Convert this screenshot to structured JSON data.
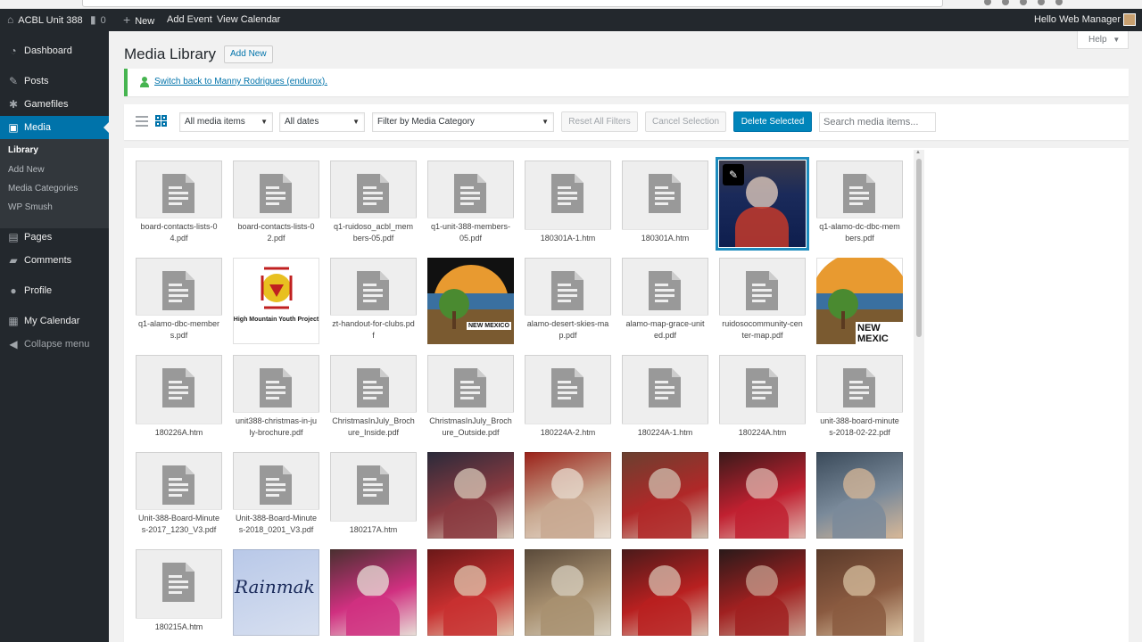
{
  "adminbar": {
    "site_name": "ACBL Unit 388",
    "comments_count": "0",
    "new_label": "New",
    "add_event_label": "Add Event",
    "view_calendar_label": "View Calendar",
    "greeting": "Hello Web Manager"
  },
  "sidebar": {
    "items": [
      {
        "key": "dashboard",
        "label": "Dashboard",
        "icon": "dashboard-icon"
      },
      {
        "key": "posts",
        "label": "Posts",
        "icon": "pin-icon"
      },
      {
        "key": "gamefiles",
        "label": "Gamefiles",
        "icon": "gear-icon"
      },
      {
        "key": "media",
        "label": "Media",
        "icon": "media-icon"
      },
      {
        "key": "pages",
        "label": "Pages",
        "icon": "page-icon"
      },
      {
        "key": "comments",
        "label": "Comments",
        "icon": "comment-icon"
      },
      {
        "key": "profile",
        "label": "Profile",
        "icon": "user-icon"
      },
      {
        "key": "calendar",
        "label": "My Calendar",
        "icon": "calendar-icon"
      },
      {
        "key": "collapse",
        "label": "Collapse menu",
        "icon": "collapse-icon"
      }
    ],
    "submenu": [
      "Library",
      "Add New",
      "Media Categories",
      "WP Smush"
    ]
  },
  "header": {
    "help_label": "Help",
    "title": "Media Library",
    "add_new_label": "Add New"
  },
  "notice": {
    "switch_back_text": "Switch back to Manny Rodrigues (endurox)."
  },
  "toolbar": {
    "filter_type": "All media items",
    "filter_date": "All dates",
    "filter_category": "Filter by Media Category",
    "reset_filters_label": "Reset All Filters",
    "cancel_selection_label": "Cancel Selection",
    "delete_selected_label": "Delete Selected",
    "search_placeholder": "Search media items..."
  },
  "media_grid": {
    "items": [
      {
        "name": "board-contacts-lists-04.pdf",
        "kind": "doc"
      },
      {
        "name": "board-contacts-lists-02.pdf",
        "kind": "doc"
      },
      {
        "name": "q1-ruidoso_acbl_members-05.pdf",
        "kind": "doc"
      },
      {
        "name": "q1-unit-388-members-05.pdf",
        "kind": "doc"
      },
      {
        "name": "180301A-1.htm",
        "kind": "doc"
      },
      {
        "name": "180301A.htm",
        "kind": "doc"
      },
      {
        "name": "",
        "kind": "photo",
        "selected": true
      },
      {
        "name": "q1-alamo-dc-dbc-members.pdf",
        "kind": "doc"
      },
      {
        "name": "q1-alamo-dbc-members.pdf",
        "kind": "doc"
      },
      {
        "name": "",
        "kind": "logo",
        "caption": "High Mountain Youth Project"
      },
      {
        "name": "zt-handout-for-clubs.pdf",
        "kind": "doc"
      },
      {
        "name": "",
        "kind": "badge",
        "caption": "NEW MEXICO"
      },
      {
        "name": "alamo-desert-skies-map.pdf",
        "kind": "doc"
      },
      {
        "name": "alamo-map-grace-united.pdf",
        "kind": "doc"
      },
      {
        "name": "ruidosocommunity-center-map.pdf",
        "kind": "doc"
      },
      {
        "name": "",
        "kind": "badge2",
        "caption": "NEW MEXIC"
      },
      {
        "name": "180226A.htm",
        "kind": "doc"
      },
      {
        "name": "unit388-christmas-in-july-brochure.pdf",
        "kind": "doc"
      },
      {
        "name": "ChristmasInJuly_Brochure_Inside.pdf",
        "kind": "doc"
      },
      {
        "name": "ChristmasInJuly_Brochure_Outside.pdf",
        "kind": "doc"
      },
      {
        "name": "180224A-2.htm",
        "kind": "doc"
      },
      {
        "name": "180224A-1.htm",
        "kind": "doc"
      },
      {
        "name": "180224A.htm",
        "kind": "doc"
      },
      {
        "name": "unit-388-board-minutes-2018-02-22.pdf",
        "kind": "doc"
      },
      {
        "name": "Unit-388-Board-Minutes-2017_1230_V3.pdf",
        "kind": "doc"
      },
      {
        "name": "Unit-388-Board-Minutes-2018_0201_V3.pdf",
        "kind": "doc"
      },
      {
        "name": "180217A.htm",
        "kind": "doc"
      },
      {
        "name": "",
        "kind": "photo"
      },
      {
        "name": "",
        "kind": "photo"
      },
      {
        "name": "",
        "kind": "photo"
      },
      {
        "name": "",
        "kind": "photo"
      },
      {
        "name": "",
        "kind": "photo"
      },
      {
        "name": "180215A.htm",
        "kind": "doc"
      },
      {
        "name": "",
        "kind": "script",
        "caption": "Rainmak"
      },
      {
        "name": "",
        "kind": "photo"
      },
      {
        "name": "",
        "kind": "photo"
      },
      {
        "name": "",
        "kind": "photo"
      },
      {
        "name": "",
        "kind": "photo"
      },
      {
        "name": "",
        "kind": "photo"
      },
      {
        "name": "",
        "kind": "photo"
      }
    ],
    "photo_palettes": [
      [
        "#5a1a14",
        "#c43a2a",
        "#e9d2c0"
      ],
      [
        "#2a2a3a",
        "#8a3a40",
        "#d8c8b8"
      ],
      [
        "#9a2018",
        "#c8a890",
        "#e8dcd0"
      ],
      [
        "#6a4030",
        "#b02828",
        "#d0c0b0"
      ],
      [
        "#3a1a1a",
        "#c02030",
        "#e0b8b0"
      ],
      [
        "#3a4a5a",
        "#7a8a9a",
        "#d8b898"
      ],
      [
        "#4a3030",
        "#d03080",
        "#e8e0d8"
      ],
      [
        "#6a1818",
        "#c83030",
        "#e0c8b0"
      ],
      [
        "#5a4a3a",
        "#a89070",
        "#d8d0c0"
      ],
      [
        "#4a1a1a",
        "#b82020",
        "#d8c0b0"
      ],
      [
        "#2a1a1a",
        "#a02020",
        "#c8a090"
      ],
      [
        "#5a3a2a",
        "#8a5a40",
        "#d8c0a0"
      ]
    ]
  }
}
